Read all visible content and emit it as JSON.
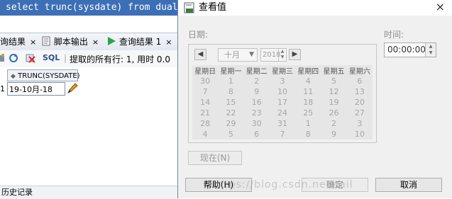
{
  "editor": {
    "sql": "select trunc(sysdate) from dual"
  },
  "tabs": [
    {
      "label": "询结果",
      "close": "×"
    },
    {
      "label": "脚本输出",
      "close": "×"
    },
    {
      "label": "查询结果 1",
      "close": "×"
    }
  ],
  "toolbar": {
    "sql_label": "SQL",
    "status": "提取的所有行: 1, 用时 0.0"
  },
  "grid": {
    "column_header": "TRUNC(SYSDATE)",
    "row_number": "1",
    "cell_value": "19-10月-18"
  },
  "history": {
    "label": "历史记录"
  },
  "dialog": {
    "title": "查看值",
    "close": "×",
    "date_label": "日期:",
    "time_label": "时间:",
    "month": "十月",
    "year": "2018",
    "time_value": "00:00:00",
    "weekdays": [
      "星期日",
      "星期一",
      "星期二",
      "星期三",
      "星期四",
      "星期五",
      "星期六"
    ],
    "weeks": [
      [
        "30",
        "1",
        "2",
        "3",
        "4",
        "5",
        "6"
      ],
      [
        "7",
        "8",
        "9",
        "10",
        "11",
        "12",
        "13"
      ],
      [
        "14",
        "15",
        "16",
        "17",
        "18",
        "19",
        "20"
      ],
      [
        "21",
        "22",
        "23",
        "24",
        "25",
        "26",
        "27"
      ],
      [
        "28",
        "29",
        "30",
        "31",
        "1",
        "2",
        "3"
      ],
      [
        "4",
        "5",
        "6",
        "7",
        "8",
        "9",
        "10"
      ]
    ],
    "now_button": "现在(N)",
    "help_button": "帮助(H)",
    "ok_button": "确定",
    "cancel_button": "取消"
  },
  "watermark": "https://blog.csdn.net/tail",
  "colors": {
    "sql_highlight": "#3d6fb6",
    "dialog_bg": "#f0f0f0",
    "disabled_text": "#a6a6a6"
  }
}
